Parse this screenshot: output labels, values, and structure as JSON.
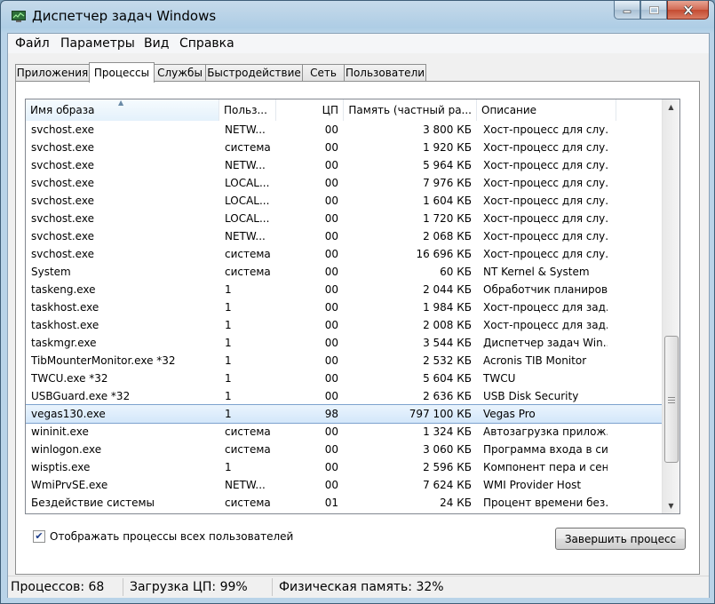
{
  "window": {
    "title": "Диспетчер задач Windows",
    "icon": "task-manager-icon",
    "accent": "#aecde5"
  },
  "menu": [
    "Файл",
    "Параметры",
    "Вид",
    "Справка"
  ],
  "tabs": [
    "Приложения",
    "Процессы",
    "Службы",
    "Быстродействие",
    "Сеть",
    "Пользователи"
  ],
  "active_tab": "Процессы",
  "columns": {
    "image": "Имя образа",
    "user": "Польз...",
    "cpu": "ЦП",
    "memory": "Память (частный ра...",
    "description": "Описание"
  },
  "rows": [
    {
      "image": "svchost.exe",
      "user": "NETW...",
      "cpu": "00",
      "memory": "3 800 КБ",
      "description": "Хост-процесс для слу..."
    },
    {
      "image": "svchost.exe",
      "user": "система",
      "cpu": "00",
      "memory": "1 920 КБ",
      "description": "Хост-процесс для слу..."
    },
    {
      "image": "svchost.exe",
      "user": "NETW...",
      "cpu": "00",
      "memory": "5 964 КБ",
      "description": "Хост-процесс для слу..."
    },
    {
      "image": "svchost.exe",
      "user": "LOCAL...",
      "cpu": "00",
      "memory": "7 976 КБ",
      "description": "Хост-процесс для слу..."
    },
    {
      "image": "svchost.exe",
      "user": "LOCAL...",
      "cpu": "00",
      "memory": "1 604 КБ",
      "description": "Хост-процесс для слу..."
    },
    {
      "image": "svchost.exe",
      "user": "LOCAL...",
      "cpu": "00",
      "memory": "1 720 КБ",
      "description": "Хост-процесс для слу..."
    },
    {
      "image": "svchost.exe",
      "user": "NETW...",
      "cpu": "00",
      "memory": "2 068 КБ",
      "description": "Хост-процесс для слу..."
    },
    {
      "image": "svchost.exe",
      "user": "система",
      "cpu": "00",
      "memory": "16 696 КБ",
      "description": "Хост-процесс для слу..."
    },
    {
      "image": "System",
      "user": "система",
      "cpu": "00",
      "memory": "60 КБ",
      "description": "NT Kernel & System"
    },
    {
      "image": "taskeng.exe",
      "user": "1",
      "cpu": "00",
      "memory": "2 044 КБ",
      "description": "Обработчик планиров..."
    },
    {
      "image": "taskhost.exe",
      "user": "1",
      "cpu": "00",
      "memory": "1 984 КБ",
      "description": "Хост-процесс для зад..."
    },
    {
      "image": "taskhost.exe",
      "user": "1",
      "cpu": "00",
      "memory": "2 008 КБ",
      "description": "Хост-процесс для зад..."
    },
    {
      "image": "taskmgr.exe",
      "user": "1",
      "cpu": "00",
      "memory": "3 544 КБ",
      "description": "Диспетчер задач Win..."
    },
    {
      "image": "TibMounterMonitor.exe *32",
      "user": "1",
      "cpu": "00",
      "memory": "2 532 КБ",
      "description": "Acronis TIB Monitor"
    },
    {
      "image": "TWCU.exe *32",
      "user": "1",
      "cpu": "00",
      "memory": "5 604 КБ",
      "description": "TWCU"
    },
    {
      "image": "USBGuard.exe *32",
      "user": "1",
      "cpu": "00",
      "memory": "2 636 КБ",
      "description": "USB Disk Security"
    },
    {
      "image": "vegas130.exe",
      "user": "1",
      "cpu": "98",
      "memory": "797 100 КБ",
      "description": "Vegas Pro",
      "selected": true
    },
    {
      "image": "wininit.exe",
      "user": "система",
      "cpu": "00",
      "memory": "1 324 КБ",
      "description": "Автозагрузка прилож..."
    },
    {
      "image": "winlogon.exe",
      "user": "система",
      "cpu": "00",
      "memory": "3 060 КБ",
      "description": "Программа входа в си..."
    },
    {
      "image": "wisptis.exe",
      "user": "1",
      "cpu": "00",
      "memory": "2 596 КБ",
      "description": "Компонент пера и сен..."
    },
    {
      "image": "WmiPrvSE.exe",
      "user": "NETW...",
      "cpu": "00",
      "memory": "7 624 КБ",
      "description": "WMI Provider Host"
    },
    {
      "image": "Бездействие системы",
      "user": "система",
      "cpu": "01",
      "memory": "24 КБ",
      "description": "Процент времени без..."
    }
  ],
  "show_all_users": {
    "label": "Отображать процессы всех пользователей",
    "checked": true
  },
  "end_process_button": "Завершить процесс",
  "status": {
    "processes": "Процессов: 68",
    "cpu_load": "Загрузка ЦП: 99%",
    "physical_memory": "Физическая память: 32%"
  },
  "scrollbar": {
    "position": 0.86,
    "visible_fraction": 0.33
  }
}
